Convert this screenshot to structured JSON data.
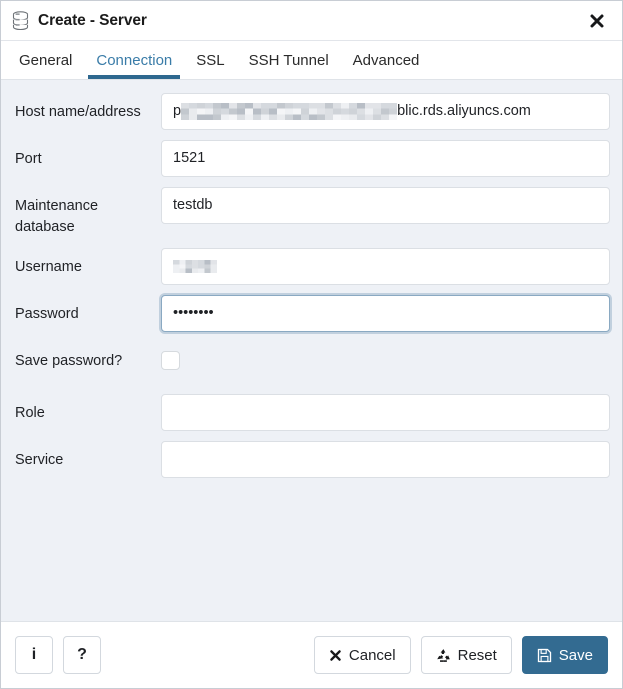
{
  "window": {
    "title": "Create - Server",
    "icon": "server-database-icon",
    "close_label": "✖"
  },
  "tabs": [
    {
      "label": "General",
      "active": false
    },
    {
      "label": "Connection",
      "active": true
    },
    {
      "label": "SSL",
      "active": false
    },
    {
      "label": "SSH Tunnel",
      "active": false
    },
    {
      "label": "Advanced",
      "active": false
    }
  ],
  "form": {
    "host": {
      "label": "Host name/address",
      "value_redacted": true,
      "value_prefix": "p",
      "value_suffix": "blic.rds.aliyuncs.com",
      "placeholder": ""
    },
    "port": {
      "label": "Port",
      "value": "1521",
      "placeholder": ""
    },
    "maintenance_database": {
      "label": "Maintenance database",
      "value": "testdb",
      "placeholder": ""
    },
    "username": {
      "label": "Username",
      "value_redacted": true,
      "value": "",
      "placeholder": ""
    },
    "password": {
      "label": "Password",
      "value": "••••••••",
      "dot_count": 8,
      "focused": true,
      "placeholder": ""
    },
    "save_password": {
      "label": "Save password?",
      "checked": false
    },
    "role": {
      "label": "Role",
      "value": "",
      "placeholder": ""
    },
    "service": {
      "label": "Service",
      "value": "",
      "placeholder": ""
    }
  },
  "footer": {
    "info_label": "i",
    "help_label": "?",
    "cancel_label": "Cancel",
    "reset_label": "Reset",
    "save_label": "Save"
  },
  "colors": {
    "accent": "#336b91",
    "tab_active_text": "#3a7ca8",
    "tab_underline": "#2e688f",
    "body_bg": "#eef1f6",
    "panel_bg": "#ffffff",
    "input_border": "#dbdfe4",
    "focus_ring": "#8aa9c2"
  }
}
